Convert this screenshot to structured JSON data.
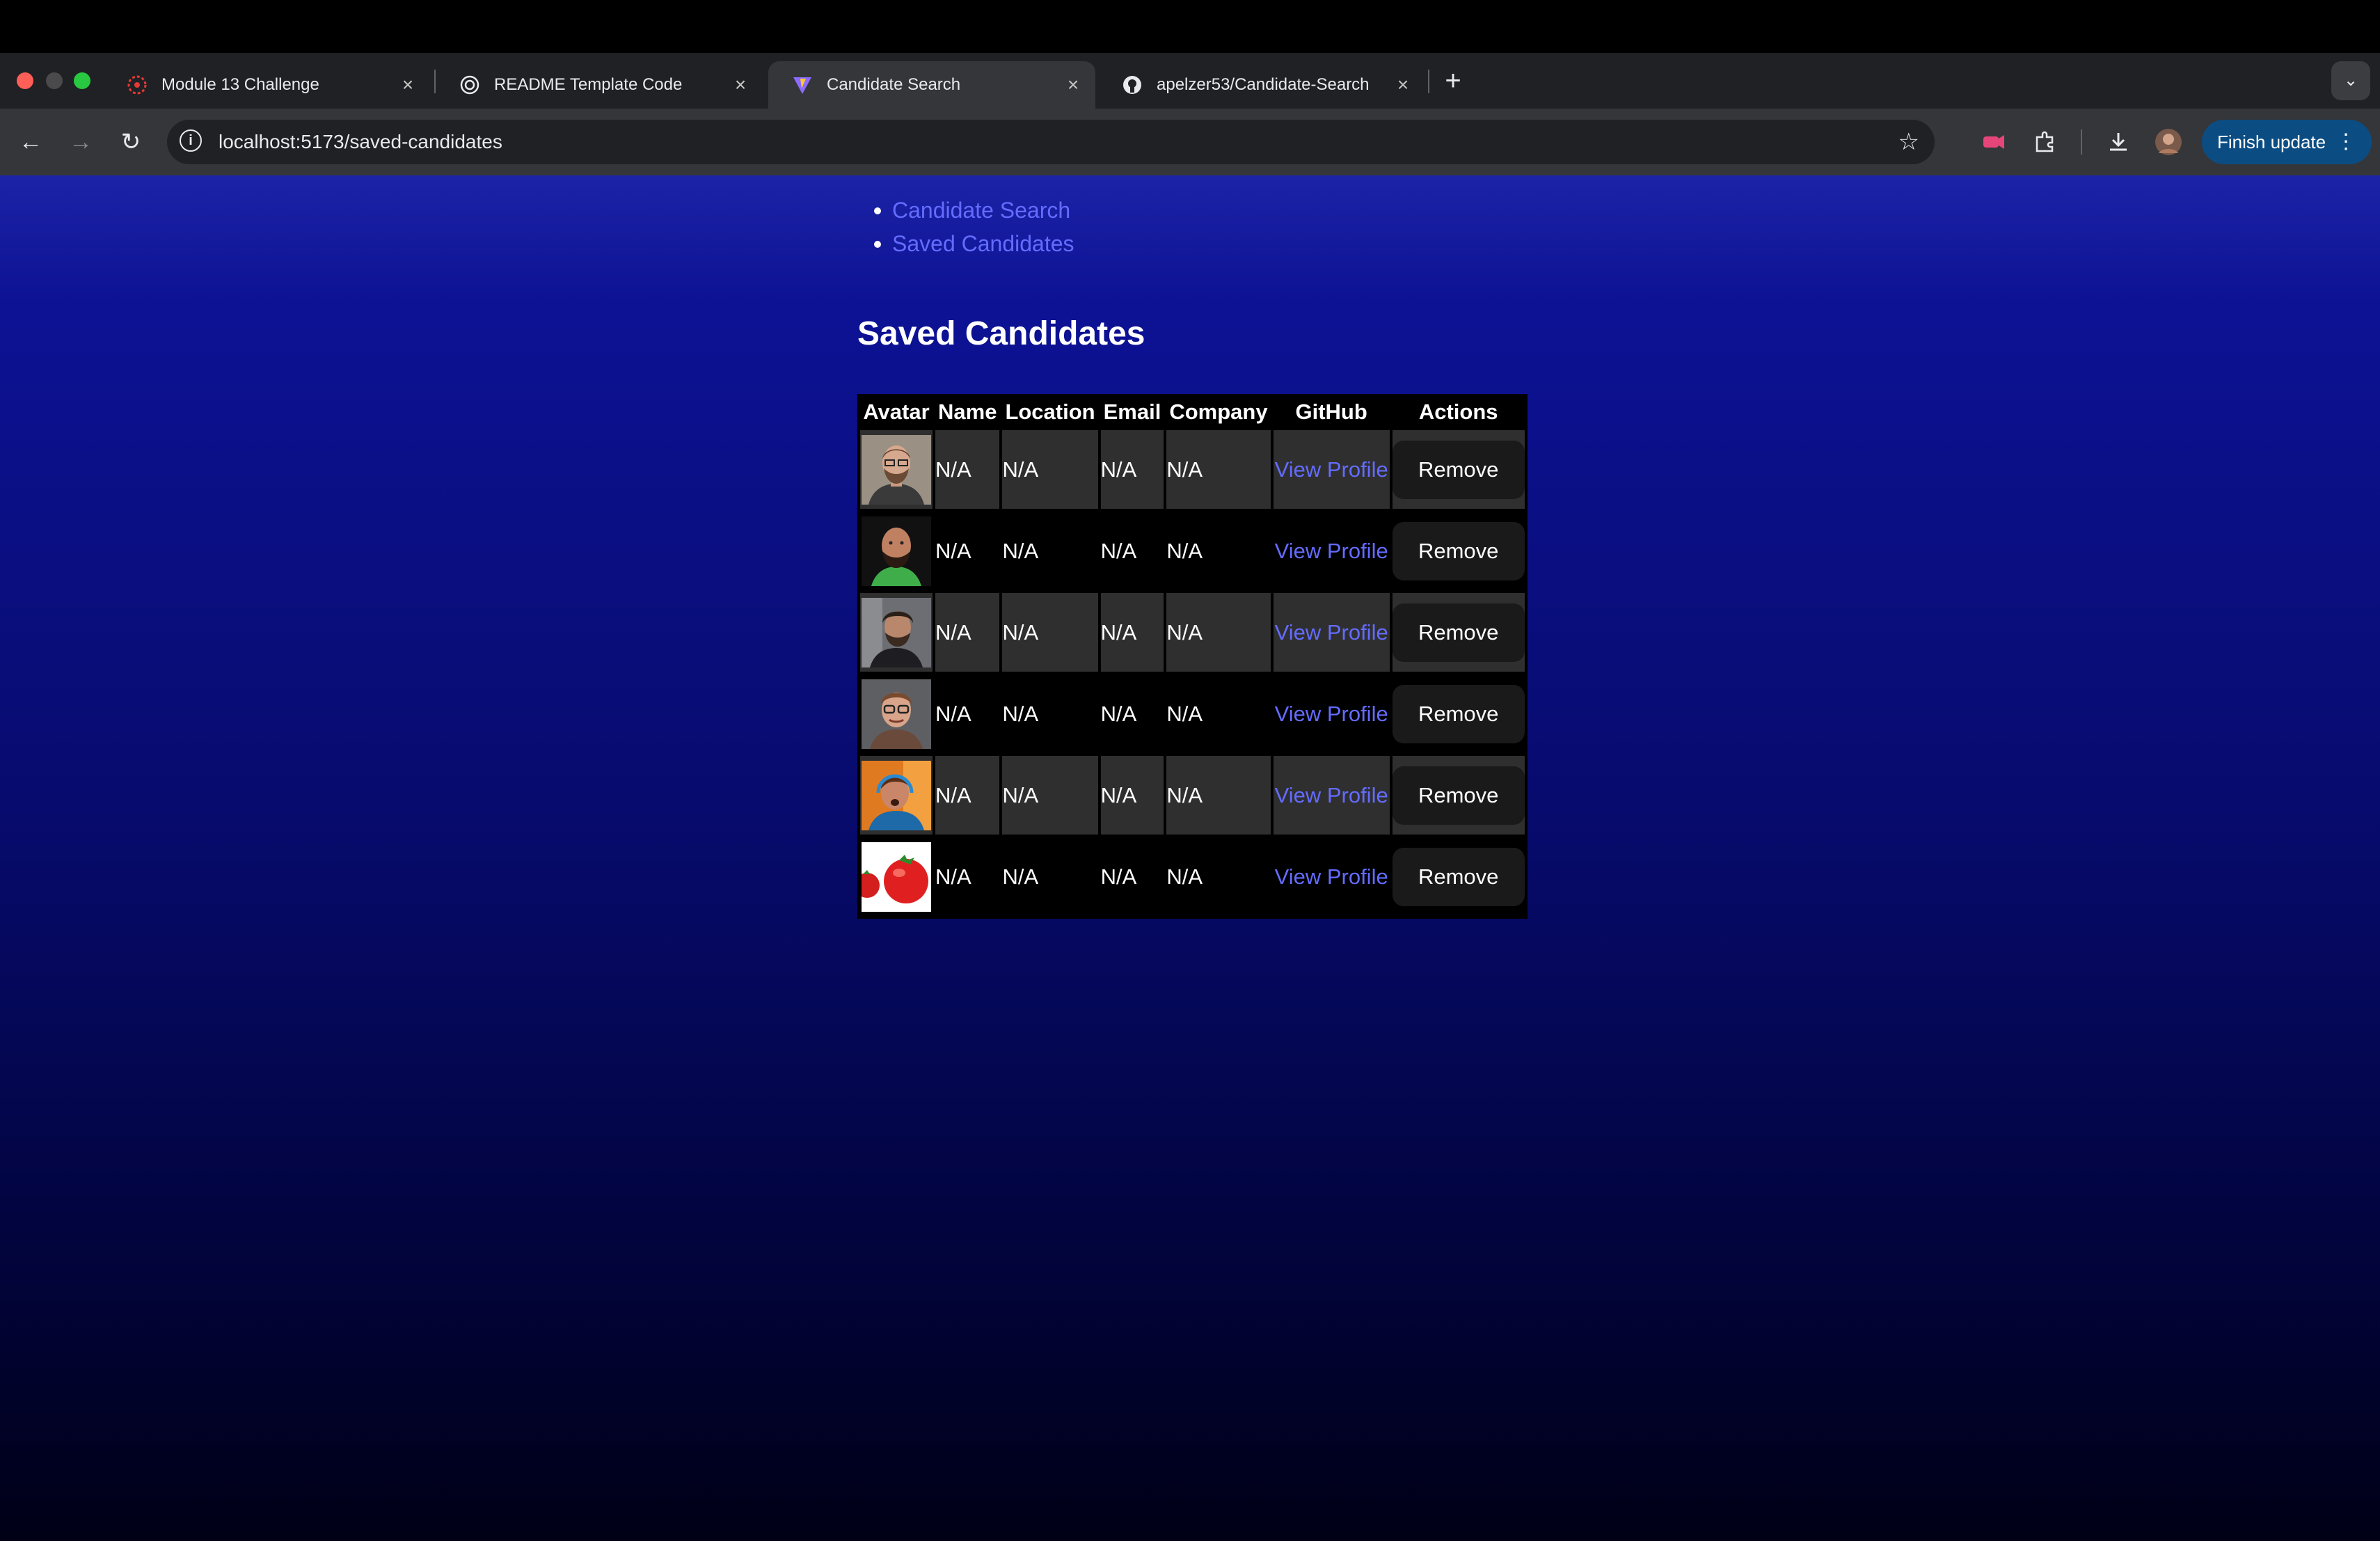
{
  "browser": {
    "tabs": [
      {
        "title": "Module 13 Challenge",
        "icon": "canvas-icon",
        "active": false
      },
      {
        "title": "README Template Code",
        "icon": "chatgpt-icon",
        "active": false
      },
      {
        "title": "Candidate Search",
        "icon": "vite-icon",
        "active": true
      },
      {
        "title": "apelzer53/Candidate-Search",
        "icon": "github-icon",
        "active": false
      }
    ],
    "url": "localhost:5173/saved-candidates",
    "finish_update_label": "Finish update"
  },
  "nav": {
    "links": [
      "Candidate Search",
      "Saved Candidates"
    ]
  },
  "page": {
    "title": "Saved Candidates"
  },
  "table": {
    "headers": [
      "Avatar",
      "Name",
      "Location",
      "Email",
      "Company",
      "GitHub",
      "Actions"
    ],
    "rows": [
      {
        "avatar": "avatar-man-glasses-beard",
        "name": "N/A",
        "location": "N/A",
        "email": "N/A",
        "company": "N/A",
        "github": "View Profile",
        "action": "Remove"
      },
      {
        "avatar": "avatar-man-bald-beard",
        "name": "N/A",
        "location": "N/A",
        "email": "N/A",
        "company": "N/A",
        "github": "View Profile",
        "action": "Remove"
      },
      {
        "avatar": "avatar-man-curly-hair",
        "name": "N/A",
        "location": "N/A",
        "email": "N/A",
        "company": "N/A",
        "github": "View Profile",
        "action": "Remove"
      },
      {
        "avatar": "avatar-man-glasses-smile",
        "name": "N/A",
        "location": "N/A",
        "email": "N/A",
        "company": "N/A",
        "github": "View Profile",
        "action": "Remove"
      },
      {
        "avatar": "avatar-man-headphones",
        "name": "N/A",
        "location": "N/A",
        "email": "N/A",
        "company": "N/A",
        "github": "View Profile",
        "action": "Remove"
      },
      {
        "avatar": "avatar-tomatoes",
        "name": "N/A",
        "location": "N/A",
        "email": "N/A",
        "company": "N/A",
        "github": "View Profile",
        "action": "Remove"
      }
    ]
  },
  "colors": {
    "link": "#646cff",
    "page_top": "#1d23a6",
    "page_bottom": "#000016",
    "finish_update_bg": "#0b4d83"
  }
}
